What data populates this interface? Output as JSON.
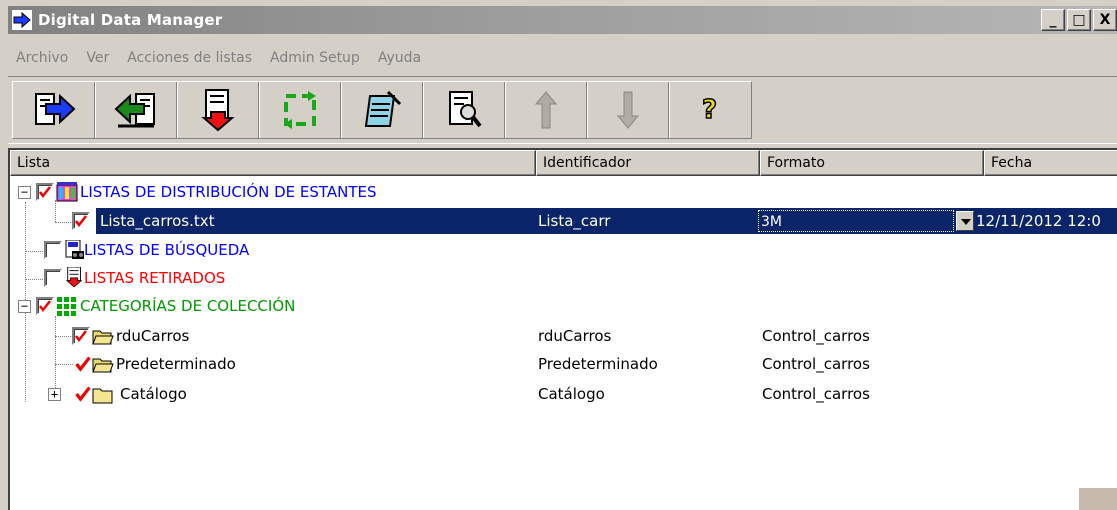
{
  "window": {
    "title": "Digital Data Manager",
    "buttons": {
      "minimize": "_",
      "maximize": "□",
      "close": "X"
    }
  },
  "menu": [
    "Archivo",
    "Ver",
    "Acciones de listas",
    "Admin Setup",
    "Ayuda"
  ],
  "toolbar": {
    "buttons": [
      {
        "name": "export-icon"
      },
      {
        "name": "import-icon"
      },
      {
        "name": "download-icon"
      },
      {
        "name": "refresh-icon"
      },
      {
        "name": "notepad-icon"
      },
      {
        "name": "search-document-icon"
      },
      {
        "name": "arrow-up-icon",
        "disabled": true
      },
      {
        "name": "arrow-down-icon",
        "disabled": true
      },
      {
        "name": "help-icon"
      }
    ]
  },
  "columns": [
    "Lista",
    "Identificador",
    "Formato",
    "Fecha"
  ],
  "rows": [
    {
      "label": "LISTAS DE DISTRIBUCIÓN DE ESTANTES",
      "id": "",
      "formato": "",
      "fecha": "",
      "color": "#0000ff"
    },
    {
      "label": "Lista_carros.txt",
      "id": "Lista_carr",
      "formato": "3M",
      "fecha": "12/11/2012 12:0",
      "selected": true
    },
    {
      "label": "LISTAS DE BÚSQUEDA",
      "id": "",
      "formato": "",
      "fecha": "",
      "color": "#0000ff"
    },
    {
      "label": "LISTAS RETIRADOS",
      "id": "",
      "formato": "",
      "fecha": "",
      "color": "#ff0000"
    },
    {
      "label": "CATEGORÍAS DE COLECCIÓN",
      "id": "",
      "formato": "",
      "fecha": "",
      "color": "#009900"
    },
    {
      "label": "rduCarros",
      "id": "rduCarros",
      "formato": "Control_carros",
      "fecha": ""
    },
    {
      "label": "Predeterminado",
      "id": "Predeterminado",
      "formato": "Control_carros",
      "fecha": ""
    },
    {
      "label": "Catálogo",
      "id": "Catálogo",
      "formato": "Control_carros",
      "fecha": ""
    }
  ],
  "expander": {
    "collapse": "−",
    "expand": "+"
  }
}
